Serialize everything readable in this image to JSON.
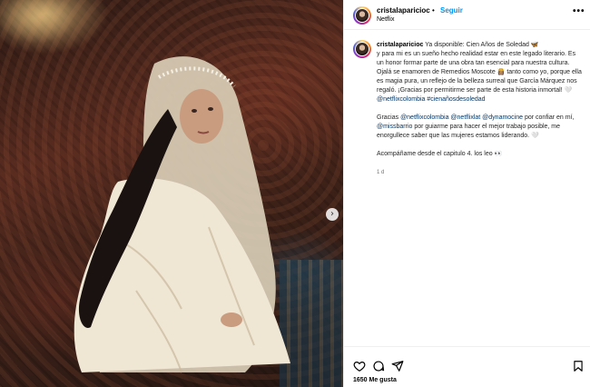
{
  "post": {
    "username": "cristalaparicioc",
    "separator": "•",
    "follow_label": "Seguir",
    "subline": "Netflix",
    "more_label": "•••",
    "carousel_next": "›"
  },
  "caption": {
    "username": "cristalaparicioc",
    "lines": [
      "Ya disponible: Cien Años de Soledad 🦋",
      "y para mi es un sueño hecho realidad estar en este legado literario. Es un honor formar parte de una obra tan esencial para nuestra cultura. Ojalá se enamoren de Remedios Moscote 👸🏽 tanto como yo, porque ella es magia pura, un reflejo de la belleza surreal que García Márquez nos regaló. ¡Gracias por permitirme ser parte de esta historia inmortal! 🤍"
    ],
    "tags_line": [
      "@netflixcolombia",
      "#cienañosdesoledad"
    ],
    "thanks": {
      "prefix": "Gracias ",
      "tag1": "@netflixcolombia",
      "tag2": "@netflixlat",
      "tag3": "@dynamocine",
      "mid": " por confiar en mí, ",
      "tag4": "@missbarrio",
      "suffix": " por guiarme para hacer el mejor trabajo posible, me enorgullece saber que las mujeres estamos liderando. 🤍"
    },
    "closing": "Acompáñame desde el capitulo 4. los leo 👀",
    "time": "1 d"
  },
  "actions": {
    "like_icon": "heart-icon",
    "comment_icon": "comment-icon",
    "share_icon": "share-icon",
    "save_icon": "bookmark-icon",
    "likes": "1650 Me gusta"
  },
  "colors": {
    "follow": "#0095f6",
    "tag": "#00376b",
    "divider": "#efefef",
    "muted": "#737373"
  }
}
